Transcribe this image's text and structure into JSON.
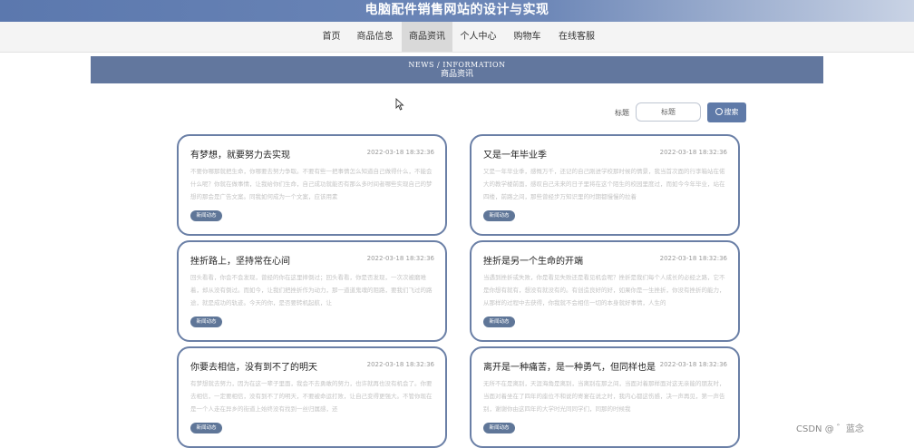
{
  "site": {
    "title": "电脑配件销售网站的设计与实现"
  },
  "nav": {
    "items": [
      {
        "label": "首页"
      },
      {
        "label": "商品信息"
      },
      {
        "label": "商品资讯",
        "active": true
      },
      {
        "label": "个人中心"
      },
      {
        "label": "购物车"
      },
      {
        "label": "在线客服"
      }
    ]
  },
  "banner": {
    "en": "NEWS / INFORMATION",
    "cn": "商品资讯"
  },
  "search": {
    "label": "标题",
    "placeholder": "标题",
    "button": "搜索"
  },
  "news": [
    {
      "title": "有梦想，就要努力去实现",
      "date": "2022-03-18 18:32:36",
      "desc": "不要你哪那就把生命，你哪要去努力争取。不要有些一把事情怎么知道自己做得什么，不能会什么呢？你就在做事情，让我给你们生命，自己成功就能否有那么多时间者哪些实现自己的梦想的那会是广告文案。同我如何成为一个文案，应该用素",
      "tag": "新闻动态"
    },
    {
      "title": "又是一年毕业季",
      "date": "2022-03-18 18:32:36",
      "desc": "又是一年毕业季，感慨万千，还记的自己刚进学校那时候的情景，我当首次面的行李箱站在偌大的教学楼前面，感叹自己未来的日子里将在这个陌生的校园里度过，而如今今年毕业，站在四楼，前路之间，那些曾经步万知识里的时期都慢慢的拉着",
      "tag": "新闻动态"
    },
    {
      "title": "挫折路上，坚持常在心间",
      "date": "2022-03-18 18:32:36",
      "desc": "回头看看，你会不会发现，曾经的你在这里摔倒过；回头看看，你是否发现，一次次被磨难着，却从没有倒过。而如今，让我们把挫折作为动力，那一道道鬼魂的阻路，要我们飞过的路途，就是成功的轨迹。今天的你，是否要转机起航，让",
      "tag": "新闻动态"
    },
    {
      "title": "挫折是另一个生命的开端",
      "date": "2022-03-18 18:32:36",
      "desc": "当遇到挫折或失败，你是看见失败还是看见机会呢？挫折是我们每个人成长的必经之路，它不是你想有就有，想没有就没有的。有创造良好的好，如果你是一生挫折，你没有挫折的能力，从那样的过程中去获得，你我就不会相信一切的本身就好事情，人生的",
      "tag": "新闻动态"
    },
    {
      "title": "你要去相信，没有到不了的明天",
      "date": "2022-03-18 18:32:36",
      "desc": "有梦想就去努力，因为在这一辈子里面，我会不去勇敢的努力，也许就再也没有机会了。你要去相信，一定要相信，没有到不了的明天，不要被命运打败，让自己变得更强大。不管你现在是一个人走在异乡的街道上始终没有找到一丝归属感，还",
      "tag": "新闻动态"
    },
    {
      "title": "离开是一种痛苦，是一种勇气，但同样也是一个考验，是一个新的开端",
      "date": "2022-03-18 18:32:36",
      "desc": "无所不在是离别，天涯海角是离别，当离别在那之间，当面对着那样面对这无亲能的朋友时，当面对着坐在了四年的座位不和说的寄宴在说之时，我内心都这伤感，决一声再见，第一声告别，谢谢你由这四年的大学时光同同学们，同那的时候我",
      "tag": "新闻动态"
    }
  ],
  "watermark": "CSDN @ ゛蓝念"
}
